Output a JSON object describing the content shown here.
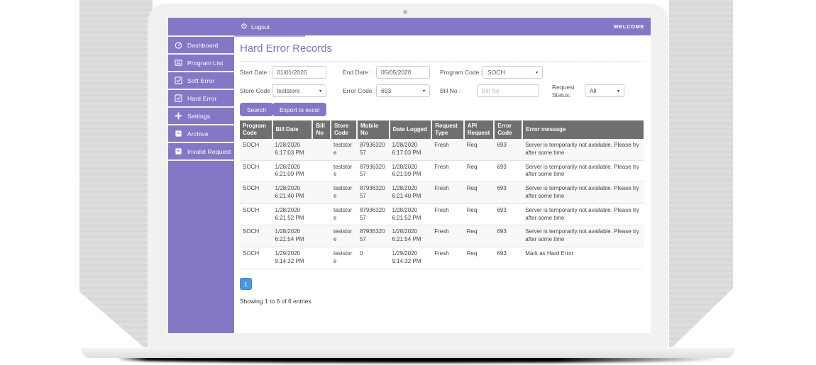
{
  "topbar": {
    "logout": "Logout",
    "welcome": "WELCOME"
  },
  "sidebar": {
    "items": [
      {
        "label": "Dashboard",
        "icon": "dashboard-icon"
      },
      {
        "label": "Program List",
        "icon": "list-icon"
      },
      {
        "label": "Soft Error",
        "icon": "check-square-icon"
      },
      {
        "label": "Hard Error",
        "icon": "check-square-icon"
      },
      {
        "label": "Settings",
        "icon": "plus-icon"
      },
      {
        "label": "Archive",
        "icon": "archive-icon"
      },
      {
        "label": "Invalid Request",
        "icon": "archive-icon"
      }
    ]
  },
  "page": {
    "title": "Hard Error Records"
  },
  "filters": {
    "start_date": {
      "label": "Start Date :",
      "value": "01/01/2020"
    },
    "end_date": {
      "label": "End Date :",
      "value": "05/05/2020"
    },
    "program_code": {
      "label": "Program Code :",
      "value": "SOCH"
    },
    "store_code": {
      "label": "Store Code :",
      "value": "teststore"
    },
    "error_code": {
      "label": "Error Code :",
      "value": "693"
    },
    "bill_no": {
      "label": "Bill No :",
      "value": "",
      "placeholder": "Bill No"
    },
    "request_status": {
      "label": "Request Status:",
      "value": "All"
    }
  },
  "actions": {
    "search": "Search",
    "export": "Export to excel"
  },
  "table": {
    "columns": [
      "Program Code",
      "Bill Date",
      "Bill No",
      "Store Code",
      "Mobile No",
      "Date Logged",
      "Request Type",
      "API Request",
      "Error Code",
      "Error message"
    ],
    "rows": [
      [
        "SOCH",
        "1/28/2020 6:17:03 PM",
        "",
        "teststore",
        "8793632057",
        "1/28/2020 6:17:03 PM",
        "Fresh",
        "Req",
        "693",
        "Server is temporarily not available. Please try after some time"
      ],
      [
        "SOCH",
        "1/28/2020 6:21:09 PM",
        "",
        "teststore",
        "8793632057",
        "1/28/2020 6:21:09 PM",
        "Fresh",
        "Req",
        "693",
        "Server is temporarily not available. Please try after some time"
      ],
      [
        "SOCH",
        "1/28/2020 6:21:40 PM",
        "",
        "teststore",
        "8793632057",
        "1/28/2020 6:21:40 PM",
        "Fresh",
        "Req",
        "693",
        "Server is temporarily not available. Please try after some time"
      ],
      [
        "SOCH",
        "1/28/2020 6:21:52 PM",
        "",
        "teststore",
        "8793632057",
        "1/28/2020 6:21:52 PM",
        "Fresh",
        "Req",
        "693",
        "Server is temporarily not available. Please try after some time"
      ],
      [
        "SOCH",
        "1/28/2020 6:21:54 PM",
        "",
        "teststore",
        "8793632057",
        "1/28/2020 6:21:54 PM",
        "Fresh",
        "Req",
        "693",
        "Server is temporarily not available. Please try after some time"
      ],
      [
        "SOCH",
        "1/29/2020 9:14:32 PM",
        "",
        "teststore",
        "0",
        "1/29/2020 9:14:32 PM",
        "Fresh",
        "Req",
        "693",
        "Mark as Hard Error"
      ]
    ]
  },
  "pagination": {
    "page": "1",
    "summary": "Showing 1 to 6 of 6 entries"
  },
  "icons": {
    "power-icon": "power symbol",
    "dashboard-icon": "gauge",
    "list-icon": "lines in box",
    "check-square-icon": "check in square",
    "plus-icon": "plus",
    "archive-icon": "filled box",
    "chevron-down-icon": "▾"
  },
  "colors": {
    "accent_purple": "#8478c6",
    "title_purple": "#7d6fc6",
    "table_header_gray": "#6f6f6f",
    "pagination_blue": "#4a99dd"
  }
}
